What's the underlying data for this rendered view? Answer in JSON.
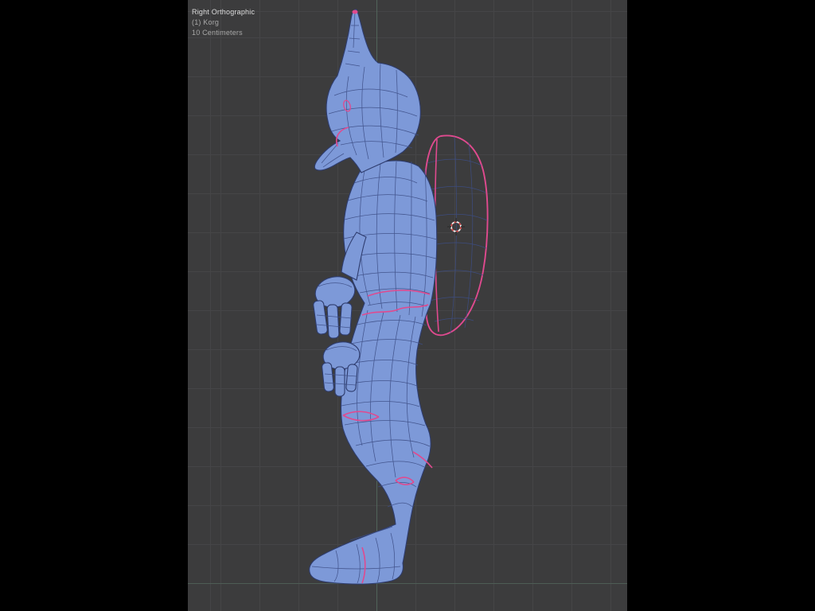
{
  "viewport": {
    "view_label": "Right Orthographic",
    "object_label": "(1) Korg",
    "scale_label": "10 Centimeters"
  },
  "colors": {
    "letterbox": "#000000",
    "viewport_bg": "#3c3c3d",
    "grid_line": "#454547",
    "axis_green": "#5f8a70",
    "text_primary": "#dcdcdc",
    "text_secondary": "#a8a8a8",
    "mesh_fill": "#7d99d8",
    "mesh_wire": "#3d4e86",
    "mesh_outline": "#2e3c6e",
    "seam_pink": "#e04a8f",
    "cursor_red": "#cc4444",
    "cursor_white": "#f0f0f0"
  }
}
